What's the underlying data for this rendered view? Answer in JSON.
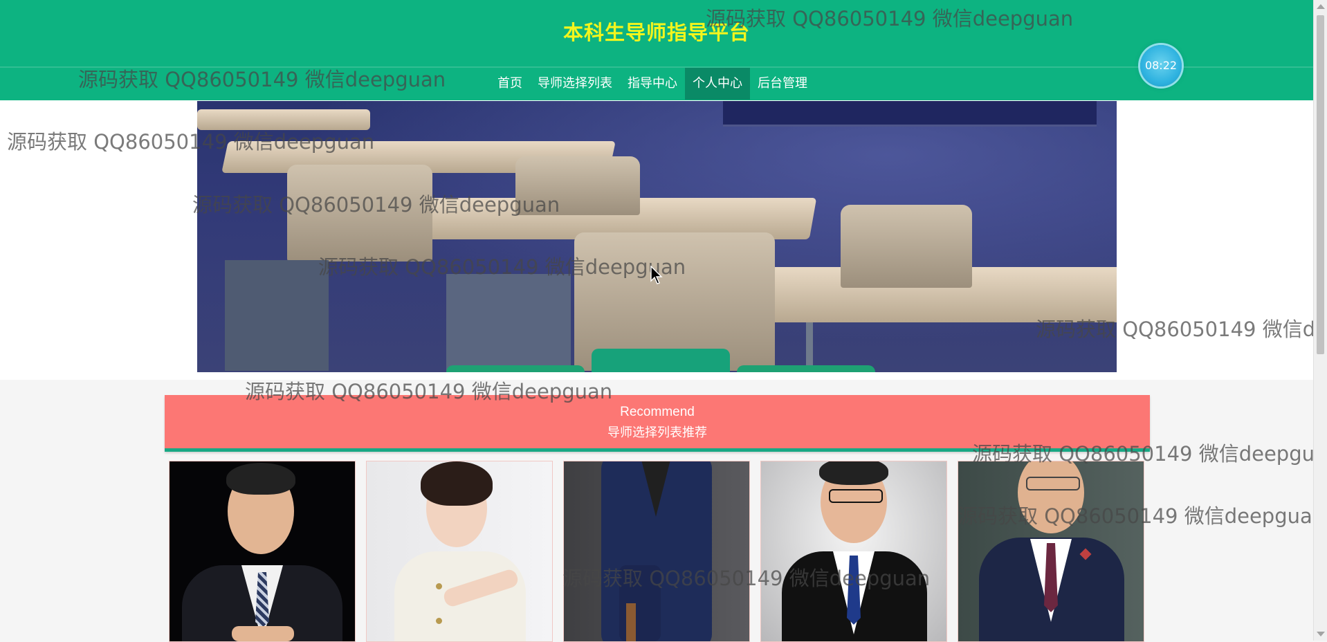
{
  "header": {
    "site_title": "本科生导师指导平台",
    "clock_time": "08:22"
  },
  "nav": {
    "items": [
      {
        "label": "首页"
      },
      {
        "label": "导师选择列表"
      },
      {
        "label": "指导中心"
      },
      {
        "label": "个人中心",
        "active": true
      },
      {
        "label": "后台管理"
      }
    ]
  },
  "recommend": {
    "title_en": "Recommend",
    "title_cn": "导师选择列表推荐"
  },
  "watermark": {
    "text": "源码获取 QQ86050149 微信deepguan",
    "text_clipped": "源码获取 QQ86050149 微信deepgua",
    "text_clipped_short": "源码获取 QQ86050149 微信de"
  },
  "colors": {
    "header_bg": "#0db381",
    "title_color": "#f3f51d",
    "nav_active_bg": "#0a8a66",
    "recommend_bg": "#fc7774",
    "recommend_border": "#17a884"
  },
  "tutor_cards": [
    {
      "photo": "tutor-photo-1"
    },
    {
      "photo": "tutor-photo-2"
    },
    {
      "photo": "tutor-photo-3"
    },
    {
      "photo": "tutor-photo-4"
    },
    {
      "photo": "tutor-photo-5"
    }
  ]
}
